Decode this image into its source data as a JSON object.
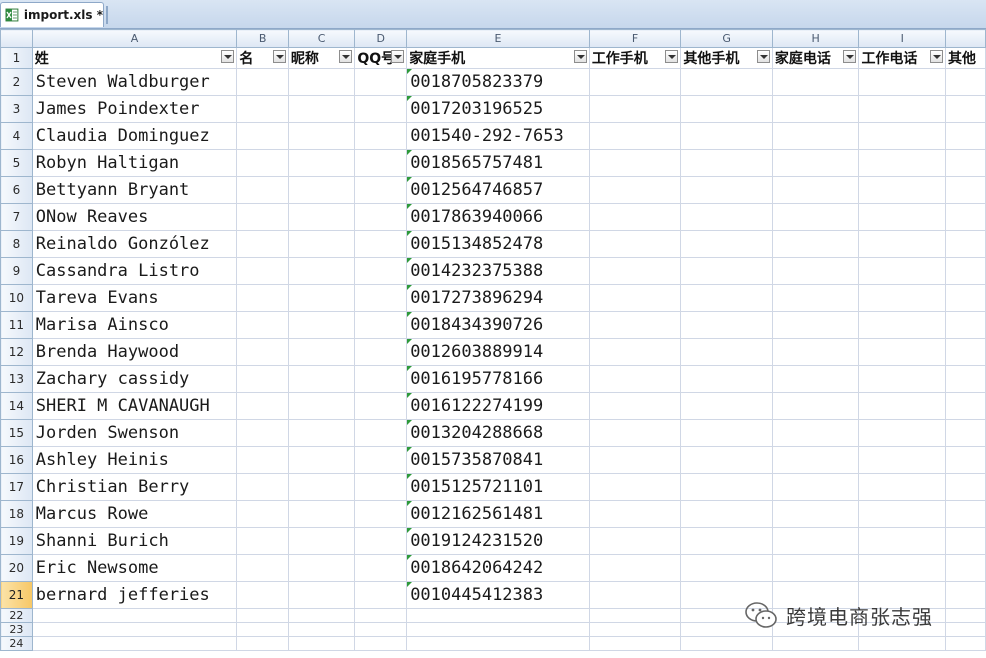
{
  "tab": {
    "title": "import.xls *",
    "icon": "excel-file-icon"
  },
  "columns": [
    "A",
    "B",
    "C",
    "D",
    "E",
    "F",
    "G",
    "H",
    "I",
    ""
  ],
  "headers": [
    "姓",
    "名",
    "昵称",
    "QQ号",
    "家庭手机",
    "工作手机",
    "其他手机",
    "家庭电话",
    "工作电话",
    "其他"
  ],
  "rows": [
    {
      "num": "2",
      "name": "Steven Waldburger",
      "phone": "0018705823379",
      "mark": true
    },
    {
      "num": "3",
      "name": "James Poindexter",
      "phone": "0017203196525",
      "mark": true
    },
    {
      "num": "4",
      "name": "Claudia Dominguez",
      "phone": "001540-292-7653",
      "mark": false
    },
    {
      "num": "5",
      "name": "Robyn Haltigan",
      "phone": "0018565757481",
      "mark": true
    },
    {
      "num": "6",
      "name": "Bettyann Bryant",
      "phone": "0012564746857",
      "mark": true
    },
    {
      "num": "7",
      "name": "ONow Reaves",
      "phone": "0017863940066",
      "mark": true
    },
    {
      "num": "8",
      "name": "Reinaldo Gonzólez",
      "phone": "0015134852478",
      "mark": true
    },
    {
      "num": "9",
      "name": "Cassandra Listro",
      "phone": "0014232375388",
      "mark": true
    },
    {
      "num": "10",
      "name": "Tareva Evans",
      "phone": "0017273896294",
      "mark": true
    },
    {
      "num": "11",
      "name": "Marisa Ainsco",
      "phone": "0018434390726",
      "mark": true
    },
    {
      "num": "12",
      "name": "Brenda Haywood",
      "phone": "0012603889914",
      "mark": true
    },
    {
      "num": "13",
      "name": "Zachary cassidy",
      "phone": "0016195778166",
      "mark": true
    },
    {
      "num": "14",
      "name": "SHERI M CAVANAUGH",
      "phone": "0016122274199",
      "mark": true
    },
    {
      "num": "15",
      "name": "Jorden Swenson",
      "phone": "0013204288668",
      "mark": true
    },
    {
      "num": "16",
      "name": "Ashley Heinis",
      "phone": "0015735870841",
      "mark": true
    },
    {
      "num": "17",
      "name": "Christian Berry",
      "phone": "0015125721101",
      "mark": true
    },
    {
      "num": "18",
      "name": "Marcus Rowe",
      "phone": "0012162561481",
      "mark": true
    },
    {
      "num": "19",
      "name": "Shanni Burich",
      "phone": "0019124231520",
      "mark": true
    },
    {
      "num": "20",
      "name": "Eric Newsome",
      "phone": "0018642064242",
      "mark": true
    },
    {
      "num": "21",
      "name": "bernard jefferies",
      "phone": "0010445412383",
      "mark": true
    }
  ],
  "empty_rows": [
    "22",
    "23",
    "24"
  ],
  "header_row_num": "1",
  "active_row": "21",
  "watermark": {
    "text": "跨境电商张志强",
    "icon": "wechat-icon"
  },
  "colors": {
    "header_bg": "#dde7f4",
    "active_row": "#f7c766",
    "error_marker": "#2e9a3b"
  }
}
